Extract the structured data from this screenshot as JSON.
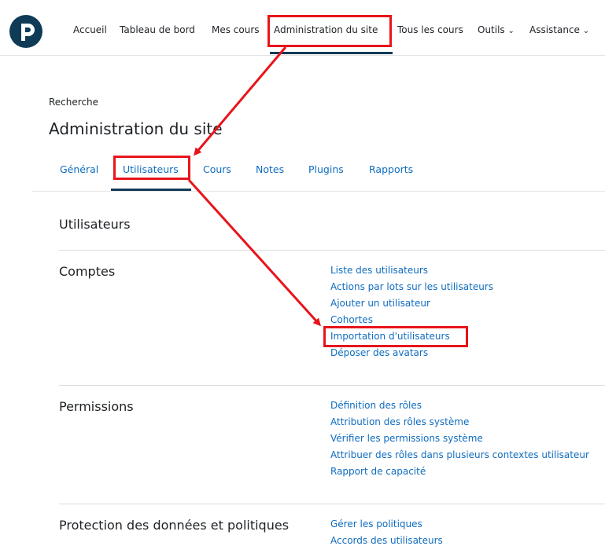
{
  "navbar": {
    "logo_letter": "P",
    "items": [
      {
        "label": "Accueil"
      },
      {
        "label": "Tableau de bord"
      },
      {
        "label": "Mes cours"
      },
      {
        "label": "Administration du site"
      },
      {
        "label": "Tous les cours"
      },
      {
        "label": "Outils"
      },
      {
        "label": "Assistance"
      }
    ],
    "dropdown_glyph": "⌄"
  },
  "breadcrumb": "Recherche",
  "page_title": "Administration du site",
  "tabs": [
    {
      "label": "Général"
    },
    {
      "label": "Utilisateurs"
    },
    {
      "label": "Cours"
    },
    {
      "label": "Notes"
    },
    {
      "label": "Plugins"
    },
    {
      "label": "Rapports"
    }
  ],
  "sections": {
    "main_heading": "Utilisateurs",
    "comptes": {
      "heading": "Comptes",
      "links": [
        "Liste des utilisateurs",
        "Actions par lots sur les utilisateurs",
        "Ajouter un utilisateur",
        "Cohortes",
        "Importation d'utilisateurs",
        "Déposer des avatars"
      ]
    },
    "permissions": {
      "heading": "Permissions",
      "links": [
        "Définition des rôles",
        "Attribution des rôles système",
        "Vérifier les permissions système",
        "Attribuer des rôles dans plusieurs contextes utilisateur",
        "Rapport de capacité"
      ]
    },
    "protection": {
      "heading": "Protection des données et politiques",
      "links": [
        "Gérer les politiques",
        "Accords des utilisateurs"
      ]
    }
  },
  "annotation_color": "#e8141b",
  "brand_color": "#0f3b57",
  "link_color": "#0f6cbf"
}
